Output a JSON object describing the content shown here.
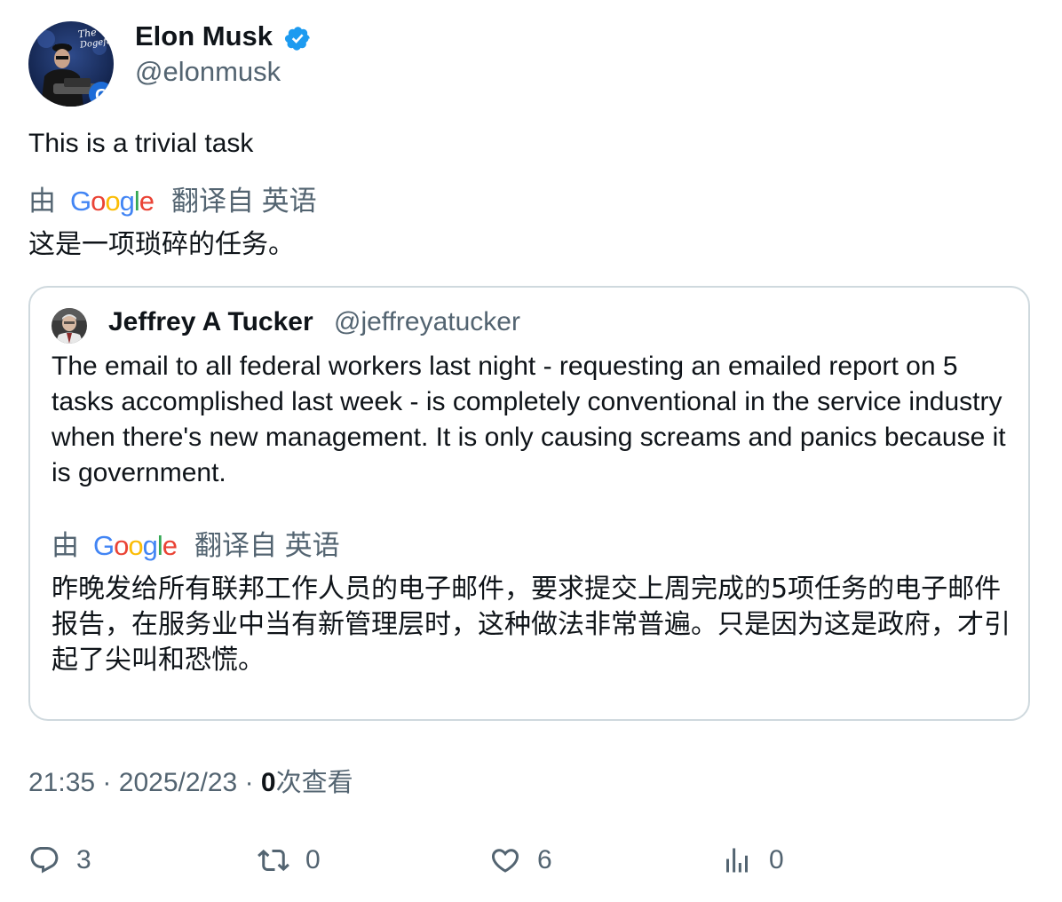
{
  "author": {
    "name": "Elon Musk",
    "handle": "@elonmusk",
    "verified": true,
    "avatar_caption": "The Dogefather"
  },
  "tweet": {
    "text": "This is a trivial task",
    "translation_prefix": "由",
    "translation_brand": "Google",
    "translation_suffix": "翻译自 英语",
    "translated_text": "这是一项琐碎的任务。"
  },
  "quoted": {
    "name": "Jeffrey A Tucker",
    "handle": "@jeffreyatucker",
    "text": "The email to all federal workers last night - requesting an emailed report on 5 tasks accomplished last week - is completely conventional in the service industry when there's new management. It is only causing screams and panics because it is government.",
    "translation_prefix": "由",
    "translation_brand": "Google",
    "translation_suffix": "翻译自 英语",
    "translated_text": "昨晚发给所有联邦工作人员的电子邮件，要求提交上周完成的5项任务的电子邮件报告，在服务业中当有新管理层时，这种做法非常普遍。只是因为这是政府，才引起了尖叫和恐慌。"
  },
  "meta": {
    "time": "21:35",
    "separator": "·",
    "date": "2025/2/23",
    "views_count": "0",
    "views_label": "次查看"
  },
  "actions": {
    "replies": "3",
    "reposts": "0",
    "likes": "6",
    "views": "0"
  },
  "colors": {
    "text": "#0f1419",
    "secondary": "#536471",
    "border": "#cfd9de",
    "verified": "#1d9bf0"
  },
  "icons": [
    "verified-badge-icon",
    "google-logo",
    "reply-icon",
    "repost-icon",
    "like-icon",
    "analytics-icon"
  ]
}
